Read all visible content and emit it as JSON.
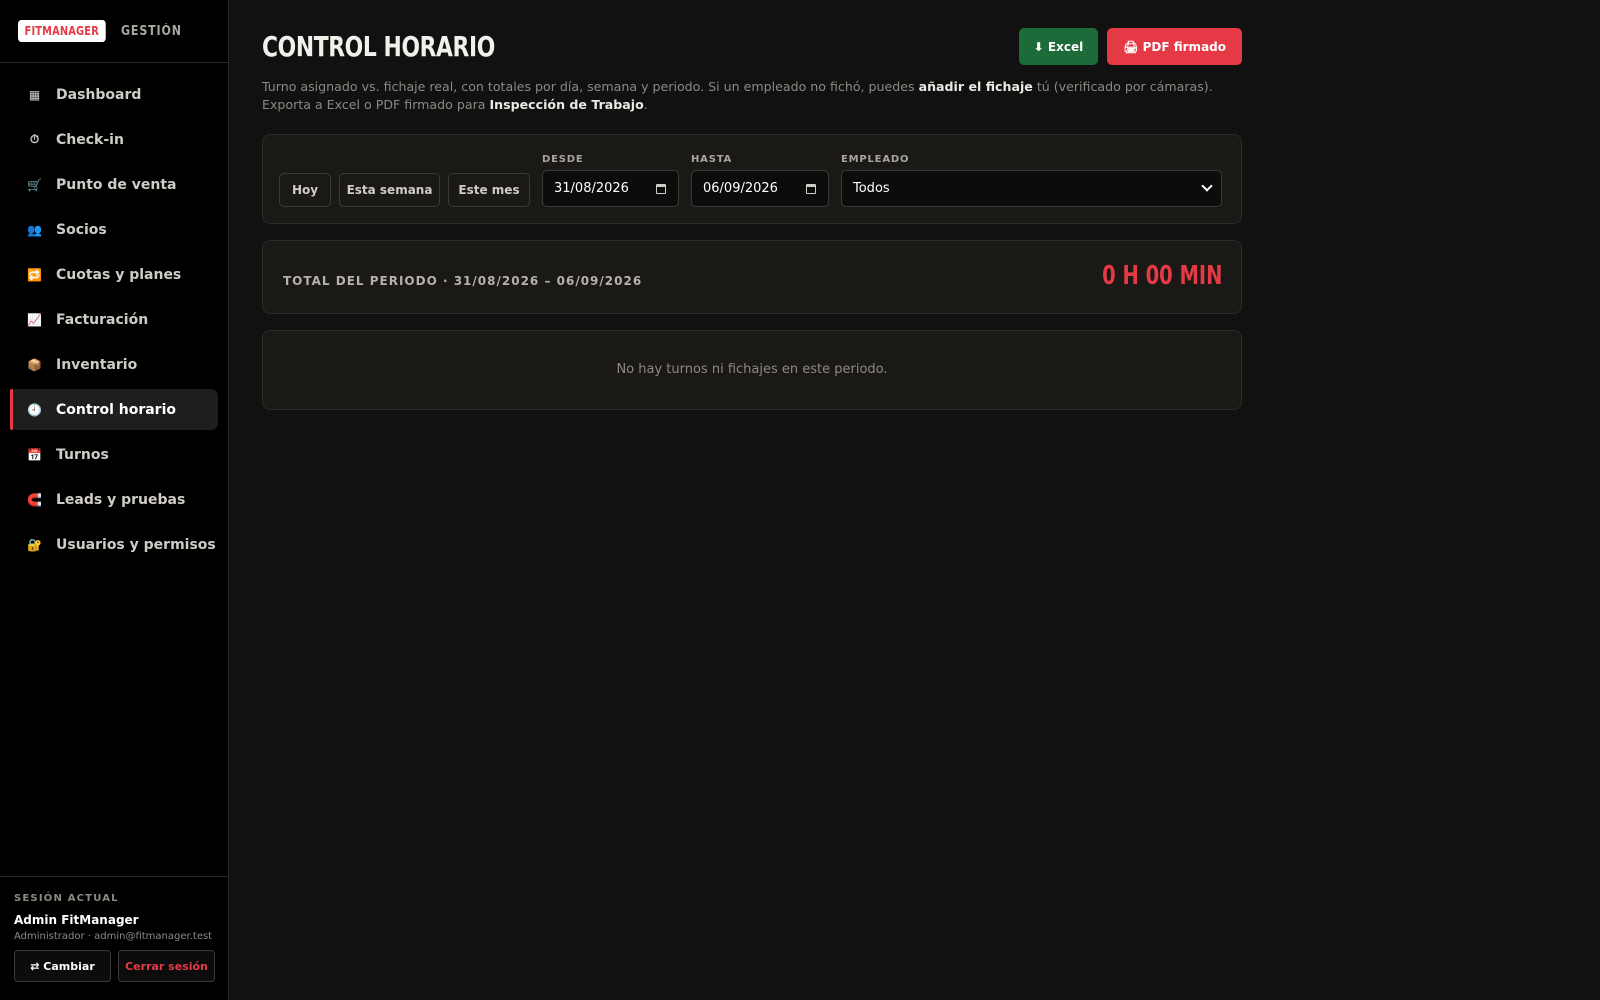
{
  "brand": {
    "logo": "FITMANAGER",
    "subtitle": "GESTIÓN"
  },
  "sidebar": {
    "items": [
      {
        "label": "Dashboard",
        "icon": "grid-icon",
        "glyph": "▦",
        "color": "#cfccc5"
      },
      {
        "label": "Check-in",
        "icon": "stopwatch-icon",
        "glyph": "⏱",
        "color": "#cfccc5"
      },
      {
        "label": "Punto de venta",
        "icon": "cart-icon",
        "glyph": "🛒",
        "color": "#cfccc5"
      },
      {
        "label": "Socios",
        "icon": "users-icon",
        "glyph": "👥",
        "color": "#7a6ad6"
      },
      {
        "label": "Cuotas y planes",
        "icon": "repeat-icon",
        "glyph": "🔁",
        "color": "#4a90e2"
      },
      {
        "label": "Facturación",
        "icon": "chart-icon",
        "glyph": "📈",
        "color": "#4a90e2"
      },
      {
        "label": "Inventario",
        "icon": "package-icon",
        "glyph": "📦",
        "color": "#c68642"
      },
      {
        "label": "Control horario",
        "icon": "clock-icon",
        "glyph": "🕘",
        "color": "#cfccc5",
        "active": true
      },
      {
        "label": "Turnos",
        "icon": "calendar-icon",
        "glyph": "📅",
        "color": "#4a90e2"
      },
      {
        "label": "Leads y pruebas",
        "icon": "magnet-icon",
        "glyph": "🧲",
        "color": "#e63946"
      },
      {
        "label": "Usuarios y permisos",
        "icon": "lock-icon",
        "glyph": "🔐",
        "color": "#e0a030"
      }
    ]
  },
  "session": {
    "label": "SESIÓN ACTUAL",
    "name": "Admin FitManager",
    "role": "Administrador · admin@fitmanager.test",
    "switch_label": "⇄ Cambiar",
    "logout_label": "Cerrar sesión"
  },
  "header": {
    "title": "CONTROL HORARIO",
    "excel_label": "⬇ Excel",
    "pdf_label": "🖨 PDF firmado",
    "description_1": "Turno asignado vs. fichaje real, con totales por día, semana y periodo. Si un empleado no fichó, puedes ",
    "description_bold_1": "añadir el fichaje",
    "description_2": " tú (verificado por cámaras). Exporta a Excel o PDF firmado para ",
    "description_bold_2": "Inspección de Trabajo",
    "description_3": "."
  },
  "filters": {
    "today": "Hoy",
    "this_week": "Esta semana",
    "this_month": "Este mes",
    "from_label": "DESDE",
    "from_value": "31/08/2026",
    "to_label": "HASTA",
    "to_value": "06/09/2026",
    "employee_label": "EMPLEADO",
    "employee_value": "Todos"
  },
  "totals": {
    "label": "TOTAL DEL PERIODO · 31/08/2026 – 06/09/2026",
    "value": "0 H 00 MIN"
  },
  "empty": {
    "message": "No hay turnos ni fichajes en este periodo."
  },
  "colors": {
    "accent": "#e63946",
    "excel": "#1d6b38",
    "background": "#111111",
    "sidebar": "#000000"
  }
}
